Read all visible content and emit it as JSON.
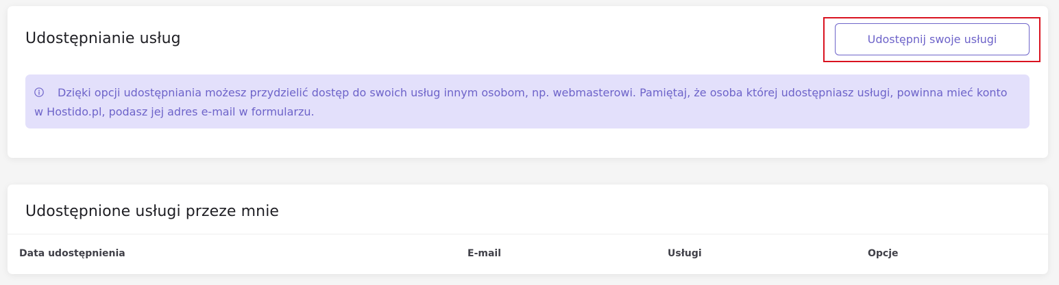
{
  "share_section": {
    "title": "Udostępnianie usług",
    "share_button_label": "Udostępnij swoje usługi",
    "info_icon": "info-circle-icon",
    "info_text": "Dzięki opcji udostępniania możesz przydzielić dostęp do swoich usług innym osobom, np. webmasterowi. Pamiętaj, że osoba której udostępniasz usługi, powinna mieć konto w Hostido.pl, podasz jej adres e-mail w formularzu.",
    "highlight_color": "#d9121f",
    "accent_color": "#6d63c9",
    "info_background": "#e3e0fb"
  },
  "shared_section": {
    "title": "Udostępnione usługi przeze mnie",
    "columns": [
      "Data udostępnienia",
      "E-mail",
      "Usługi",
      "Opcje"
    ],
    "rows": []
  }
}
